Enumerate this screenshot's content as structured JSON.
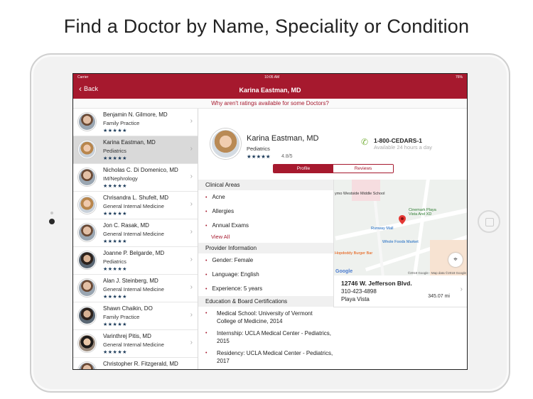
{
  "headline": "Find a Doctor by Name, Speciality or Condition",
  "status_bar": {
    "carrier": "Carrier",
    "time": "10:05 AM",
    "battery": "76%"
  },
  "nav": {
    "back_label": "Back",
    "title": "Karina Eastman, MD"
  },
  "banner": "Why aren't ratings available for some Doctors?",
  "doctors": [
    {
      "name": "Benjamin N. Gilmore, MD",
      "specialty": "Family Practice",
      "stars": "★★★★★"
    },
    {
      "name": "Karina Eastman, MD",
      "specialty": "Pediatrics",
      "stars": "★★★★★"
    },
    {
      "name": "Nicholas C. Di Domenico, MD",
      "specialty": "IM/Nephrology",
      "stars": "★★★★★"
    },
    {
      "name": "Chrisandra L. Shufelt, MD",
      "specialty": "General Internal Medicine",
      "stars": "★★★★★"
    },
    {
      "name": "Jon C. Rasak, MD",
      "specialty": "General Internal Medicine",
      "stars": "★★★★★"
    },
    {
      "name": "Joanne P. Belgarde, MD",
      "specialty": "Pediatrics",
      "stars": "★★★★★"
    },
    {
      "name": "Alan J. Steinberg, MD",
      "specialty": "General Internal Medicine",
      "stars": "★★★★★"
    },
    {
      "name": "Shawn Chaikin, DO",
      "specialty": "Family Practice",
      "stars": "★★★★★"
    },
    {
      "name": "Varinthrej Pitis, MD",
      "specialty": "General Internal Medicine",
      "stars": "★★★★★"
    },
    {
      "name": "Christopher R. Fitzgerald, MD",
      "specialty": "",
      "stars": ""
    }
  ],
  "profile": {
    "name": "Karina Eastman, MD",
    "specialty": "Pediatrics",
    "stars": "★★★★★",
    "rating": "4.8/5",
    "phone": "1-800-CEDARS-1",
    "phone_hours": "Available 24 hours a day",
    "tab_profile": "Profile",
    "tab_reviews": "Reviews"
  },
  "clinical": {
    "heading": "Clinical Areas",
    "items": [
      "Acne",
      "Allergies",
      "Annual Exams"
    ],
    "view_all": "View All"
  },
  "provider": {
    "heading": "Provider Information",
    "gender": "Gender: Female",
    "language": "Language: English",
    "experience": "Experience: 5 years"
  },
  "education": {
    "heading": "Education & Board Certifications",
    "items": [
      "Medical School: University of Vermont College of Medicine, 2014",
      "Internship: UCLA Medical Center - Pediatrics, 2015",
      "Residency: UCLA Medical Center - Pediatrics, 2017"
    ]
  },
  "map": {
    "labels": {
      "school": "ymo Westside Middle School",
      "cinemark": "Cinemark Playa Vista And XD",
      "runway": "Runway Mall",
      "whole_foods": "Whole Foods Market",
      "burger": "Hopdoddy Burger Bar",
      "google": "Google",
      "copyright": "©2018 Google - Map data ©2018 Google"
    }
  },
  "address": {
    "street": "12746 W. Jefferson Blvd.",
    "phone": "310-423-4898",
    "city": "Playa Vista",
    "distance": "345.07 mi"
  },
  "colors": {
    "brand": "#a6192e",
    "star": "#1c3b5a",
    "phone_icon": "#7cb342"
  }
}
